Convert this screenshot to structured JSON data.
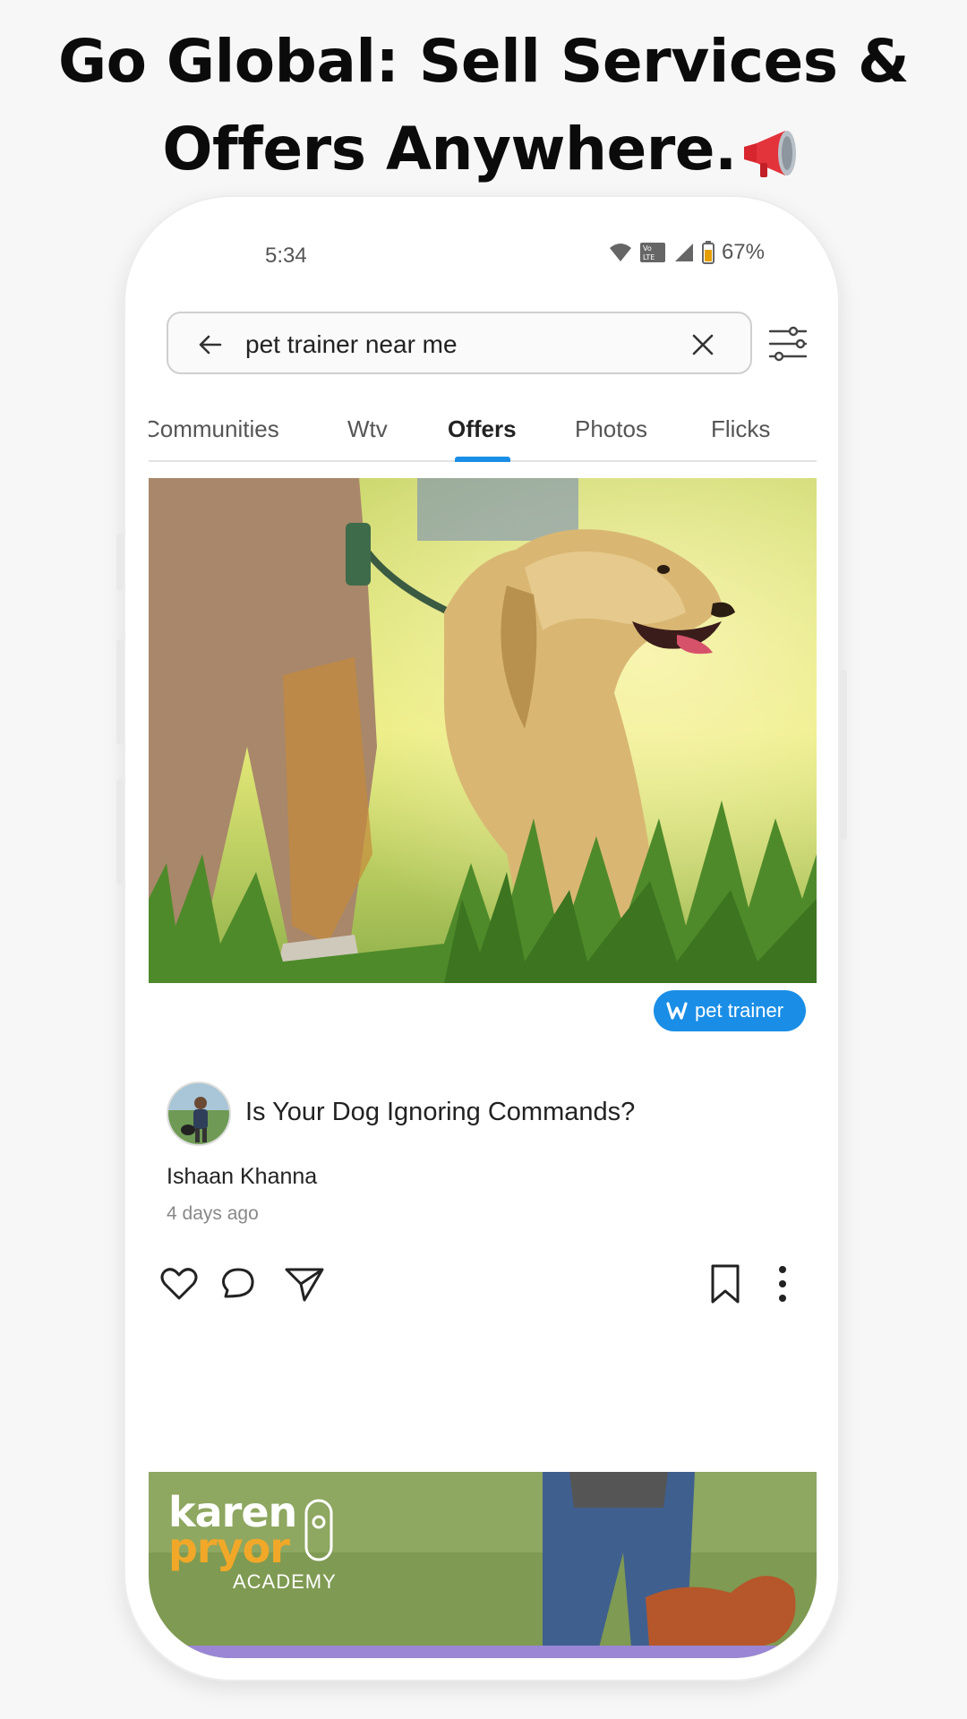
{
  "headline": {
    "line1": "Go Global: Sell Services &",
    "line2": "Offers Anywhere.",
    "icon": "megaphone-icon"
  },
  "status_bar": {
    "time": "5:34",
    "battery": "67%",
    "icons": [
      "wifi-icon",
      "volte-icon",
      "signal-icon",
      "battery-icon"
    ]
  },
  "search": {
    "query": "pet trainer near me",
    "icons": [
      "back-arrow-icon",
      "clear-icon",
      "filter-sliders-icon"
    ]
  },
  "tabs": [
    {
      "label": "Communities",
      "active": false
    },
    {
      "label": "Wtv",
      "active": false
    },
    {
      "label": "Offers",
      "active": true
    },
    {
      "label": "Photos",
      "active": false
    },
    {
      "label": "Flicks",
      "active": false
    }
  ],
  "post": {
    "tag": "pet trainer",
    "title": "Is Your Dog Ignoring Commands?",
    "author": "Ishaan Khanna",
    "time": "4 days ago",
    "actions": [
      "heart-icon",
      "comment-icon",
      "share-icon",
      "bookmark-icon",
      "more-icon"
    ]
  },
  "next_post": {
    "brand_line1": "karen",
    "brand_line2": "pryor",
    "brand_line3": "ACADEMY"
  },
  "colors": {
    "accent": "#1a8ee6",
    "brand_orange": "#f1a828"
  }
}
